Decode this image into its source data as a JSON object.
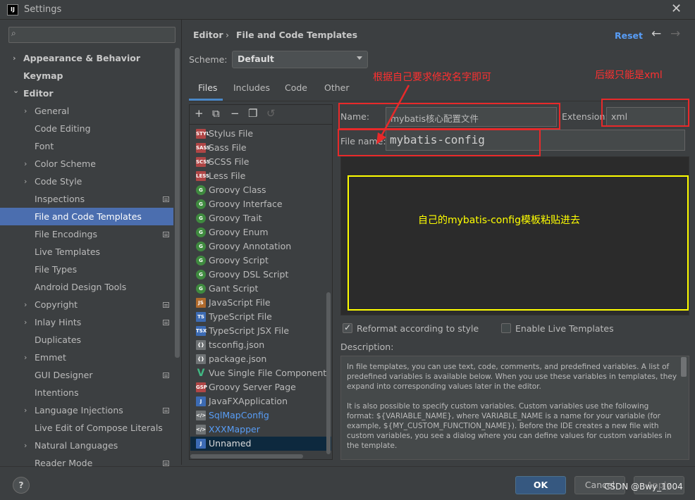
{
  "window": {
    "title": "Settings",
    "app_icon": "IJ"
  },
  "search": {
    "placeholder": ""
  },
  "sidebar": {
    "items": [
      {
        "label": "Appearance & Behavior",
        "level": 0,
        "expandable": true,
        "expanded": false,
        "bold": true
      },
      {
        "label": "Keymap",
        "level": 0,
        "expandable": false,
        "bold": true
      },
      {
        "label": "Editor",
        "level": 0,
        "expandable": true,
        "expanded": true,
        "bold": true
      },
      {
        "label": "General",
        "level": 1,
        "expandable": true
      },
      {
        "label": "Code Editing",
        "level": 1
      },
      {
        "label": "Font",
        "level": 1
      },
      {
        "label": "Color Scheme",
        "level": 1,
        "expandable": true
      },
      {
        "label": "Code Style",
        "level": 1,
        "expandable": true
      },
      {
        "label": "Inspections",
        "level": 1,
        "icon": true
      },
      {
        "label": "File and Code Templates",
        "level": 1,
        "selected": true
      },
      {
        "label": "File Encodings",
        "level": 1,
        "icon": true
      },
      {
        "label": "Live Templates",
        "level": 1
      },
      {
        "label": "File Types",
        "level": 1
      },
      {
        "label": "Android Design Tools",
        "level": 1
      },
      {
        "label": "Copyright",
        "level": 1,
        "expandable": true,
        "icon": true
      },
      {
        "label": "Inlay Hints",
        "level": 1,
        "expandable": true,
        "icon": true
      },
      {
        "label": "Duplicates",
        "level": 1
      },
      {
        "label": "Emmet",
        "level": 1,
        "expandable": true
      },
      {
        "label": "GUI Designer",
        "level": 1,
        "icon": true
      },
      {
        "label": "Intentions",
        "level": 1
      },
      {
        "label": "Language Injections",
        "level": 1,
        "expandable": true,
        "icon": true
      },
      {
        "label": "Live Edit of Compose Literals",
        "level": 1
      },
      {
        "label": "Natural Languages",
        "level": 1,
        "expandable": true
      },
      {
        "label": "Reader Mode",
        "level": 1,
        "icon": true
      }
    ]
  },
  "header": {
    "crumb_parent": "Editor",
    "crumb_sep": "›",
    "crumb_current": "File and Code Templates",
    "reset": "Reset"
  },
  "scheme": {
    "label": "Scheme:",
    "value": "Default"
  },
  "tabs": [
    "Files",
    "Includes",
    "Code",
    "Other"
  ],
  "files": [
    {
      "name": "Stylus File",
      "icon": "STYL",
      "color": "red"
    },
    {
      "name": "Sass File",
      "icon": "SASS",
      "color": "red"
    },
    {
      "name": "SCSS File",
      "icon": "SCSS",
      "color": "red"
    },
    {
      "name": "Less File",
      "icon": "LESS",
      "color": "red"
    },
    {
      "name": "Groovy Class",
      "icon": "G",
      "color": "green"
    },
    {
      "name": "Groovy Interface",
      "icon": "G",
      "color": "green"
    },
    {
      "name": "Groovy Trait",
      "icon": "G",
      "color": "green"
    },
    {
      "name": "Groovy Enum",
      "icon": "G",
      "color": "green"
    },
    {
      "name": "Groovy Annotation",
      "icon": "G",
      "color": "green"
    },
    {
      "name": "Groovy Script",
      "icon": "G",
      "color": "green"
    },
    {
      "name": "Groovy DSL Script",
      "icon": "G",
      "color": "green"
    },
    {
      "name": "Gant Script",
      "icon": "G",
      "color": "green"
    },
    {
      "name": "JavaScript File",
      "icon": "JS",
      "color": "orange"
    },
    {
      "name": "TypeScript File",
      "icon": "TS",
      "color": "blue"
    },
    {
      "name": "TypeScript JSX File",
      "icon": "TSX",
      "color": "blue"
    },
    {
      "name": "tsconfig.json",
      "icon": "{}",
      "color": "gray"
    },
    {
      "name": "package.json",
      "icon": "{}",
      "color": "gray"
    },
    {
      "name": "Vue Single File Component",
      "icon": "V",
      "color": "vue"
    },
    {
      "name": "Groovy Server Page",
      "icon": "GSP",
      "color": "red"
    },
    {
      "name": "JavaFXApplication",
      "icon": "J",
      "color": "blue"
    },
    {
      "name": "SqlMapConfig",
      "icon": "</>",
      "color": "gray",
      "link": true
    },
    {
      "name": "XXXMapper",
      "icon": "</>",
      "color": "gray",
      "link": true
    },
    {
      "name": "Unnamed",
      "icon": "J",
      "color": "blue",
      "selected": true
    }
  ],
  "form": {
    "name_label": "Name:",
    "name_value": "mybatis核心配置文件",
    "extension_label": "Extension:",
    "extension_value": "xml",
    "filename_label": "File name:",
    "filename_value": "mybatis-config"
  },
  "options": {
    "reformat": "Reformat according to style",
    "reformat_checked": true,
    "live": "Enable Live Templates",
    "live_checked": false
  },
  "description": {
    "label": "Description:",
    "p1": "In file templates, you can use text, code, comments, and predefined variables. A list of predefined variables is available below. When you use these variables in templates, they expand into corresponding values later in the editor.",
    "p2": "It is also possible to specify custom variables. Custom variables use the following format: ${VARIABLE_NAME}, where VARIABLE_NAME is a name for your variable (for example, ${MY_CUSTOM_FUNCTION_NAME}). Before the IDE creates a new file with custom variables, you see a dialog where you can define values for custom variables in the template."
  },
  "footer": {
    "help": "?",
    "ok": "OK",
    "cancel": "Cancel",
    "apply": "Apply"
  },
  "annotations": {
    "rename": "根据自己要求修改名字即可",
    "suffix": "后缀只能是xml",
    "paste": "自己的mybatis-config模板粘贴进去",
    "watermark": "CSDN @Bwy_1004"
  }
}
